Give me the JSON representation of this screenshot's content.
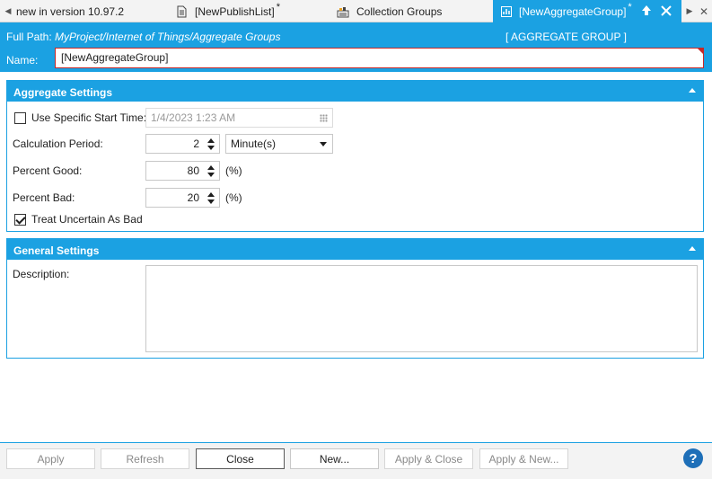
{
  "tabs": [
    {
      "label": "new in version 10.97.2",
      "modified": false,
      "active": false,
      "icon": "none"
    },
    {
      "label": "[NewPublishList]",
      "modified": true,
      "active": false,
      "icon": "document-icon"
    },
    {
      "label": "Collection Groups",
      "modified": false,
      "active": false,
      "icon": "collection-groups-icon"
    },
    {
      "label": "[NewAggregateGroup]",
      "modified": true,
      "active": true,
      "icon": "aggregate-group-icon"
    }
  ],
  "tab_modified_marker": "*",
  "header": {
    "path_label": "Full Path:",
    "path_value": "MyProject/Internet of Things/Aggregate Groups",
    "type_label": "[ AGGREGATE GROUP ]",
    "name_label": "Name:",
    "name_value": "[NewAggregateGroup]"
  },
  "aggregate_settings": {
    "title": "Aggregate Settings",
    "use_start_time": {
      "label": "Use Specific Start Time:",
      "checked": false,
      "value": "1/4/2023 1:23 AM"
    },
    "calc_period": {
      "label": "Calculation Period:",
      "value": "2",
      "unit": "Minute(s)"
    },
    "percent_good": {
      "label": "Percent Good:",
      "value": "80",
      "unit": "(%)"
    },
    "percent_bad": {
      "label": "Percent Bad:",
      "value": "20",
      "unit": "(%)"
    },
    "treat_uncertain": {
      "label": "Treat Uncertain As Bad",
      "checked": true
    }
  },
  "general_settings": {
    "title": "General Settings",
    "description_label": "Description:",
    "description_value": ""
  },
  "footer": {
    "apply": "Apply",
    "refresh": "Refresh",
    "close": "Close",
    "new": "New...",
    "apply_close": "Apply & Close",
    "apply_new": "Apply & New...",
    "help": "?"
  },
  "colors": {
    "accent": "#1ba1e2",
    "error_border": "#c62828",
    "help": "#1e6fb8"
  }
}
